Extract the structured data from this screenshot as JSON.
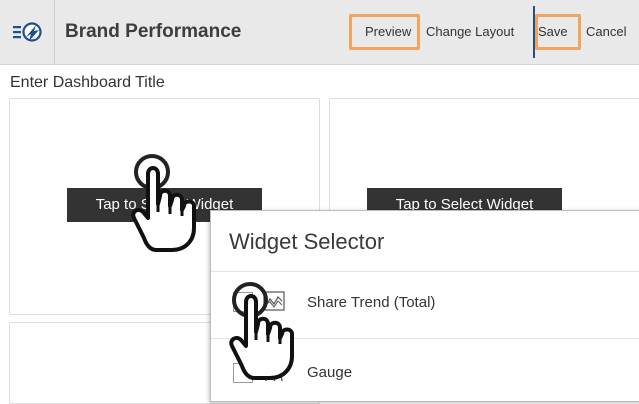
{
  "header": {
    "title": "Brand Performance",
    "logo_icon": "menu-logo-icon",
    "preview_label": "Preview",
    "change_layout_label": "Change Layout",
    "save_label": "Save",
    "cancel_label": "Cancel",
    "highlight_color": "#f0a45c",
    "accent_color": "#1f4f86"
  },
  "dashboard": {
    "title": "Enter Dashboard Title",
    "widget_button_label": "Tap to Select Widget"
  },
  "widget_selector": {
    "title": "Widget Selector",
    "items": [
      {
        "label": "Share Trend (Total)",
        "icon": "trend-chart-icon"
      },
      {
        "label": "Gauge",
        "icon": "gauge-icon"
      }
    ]
  }
}
